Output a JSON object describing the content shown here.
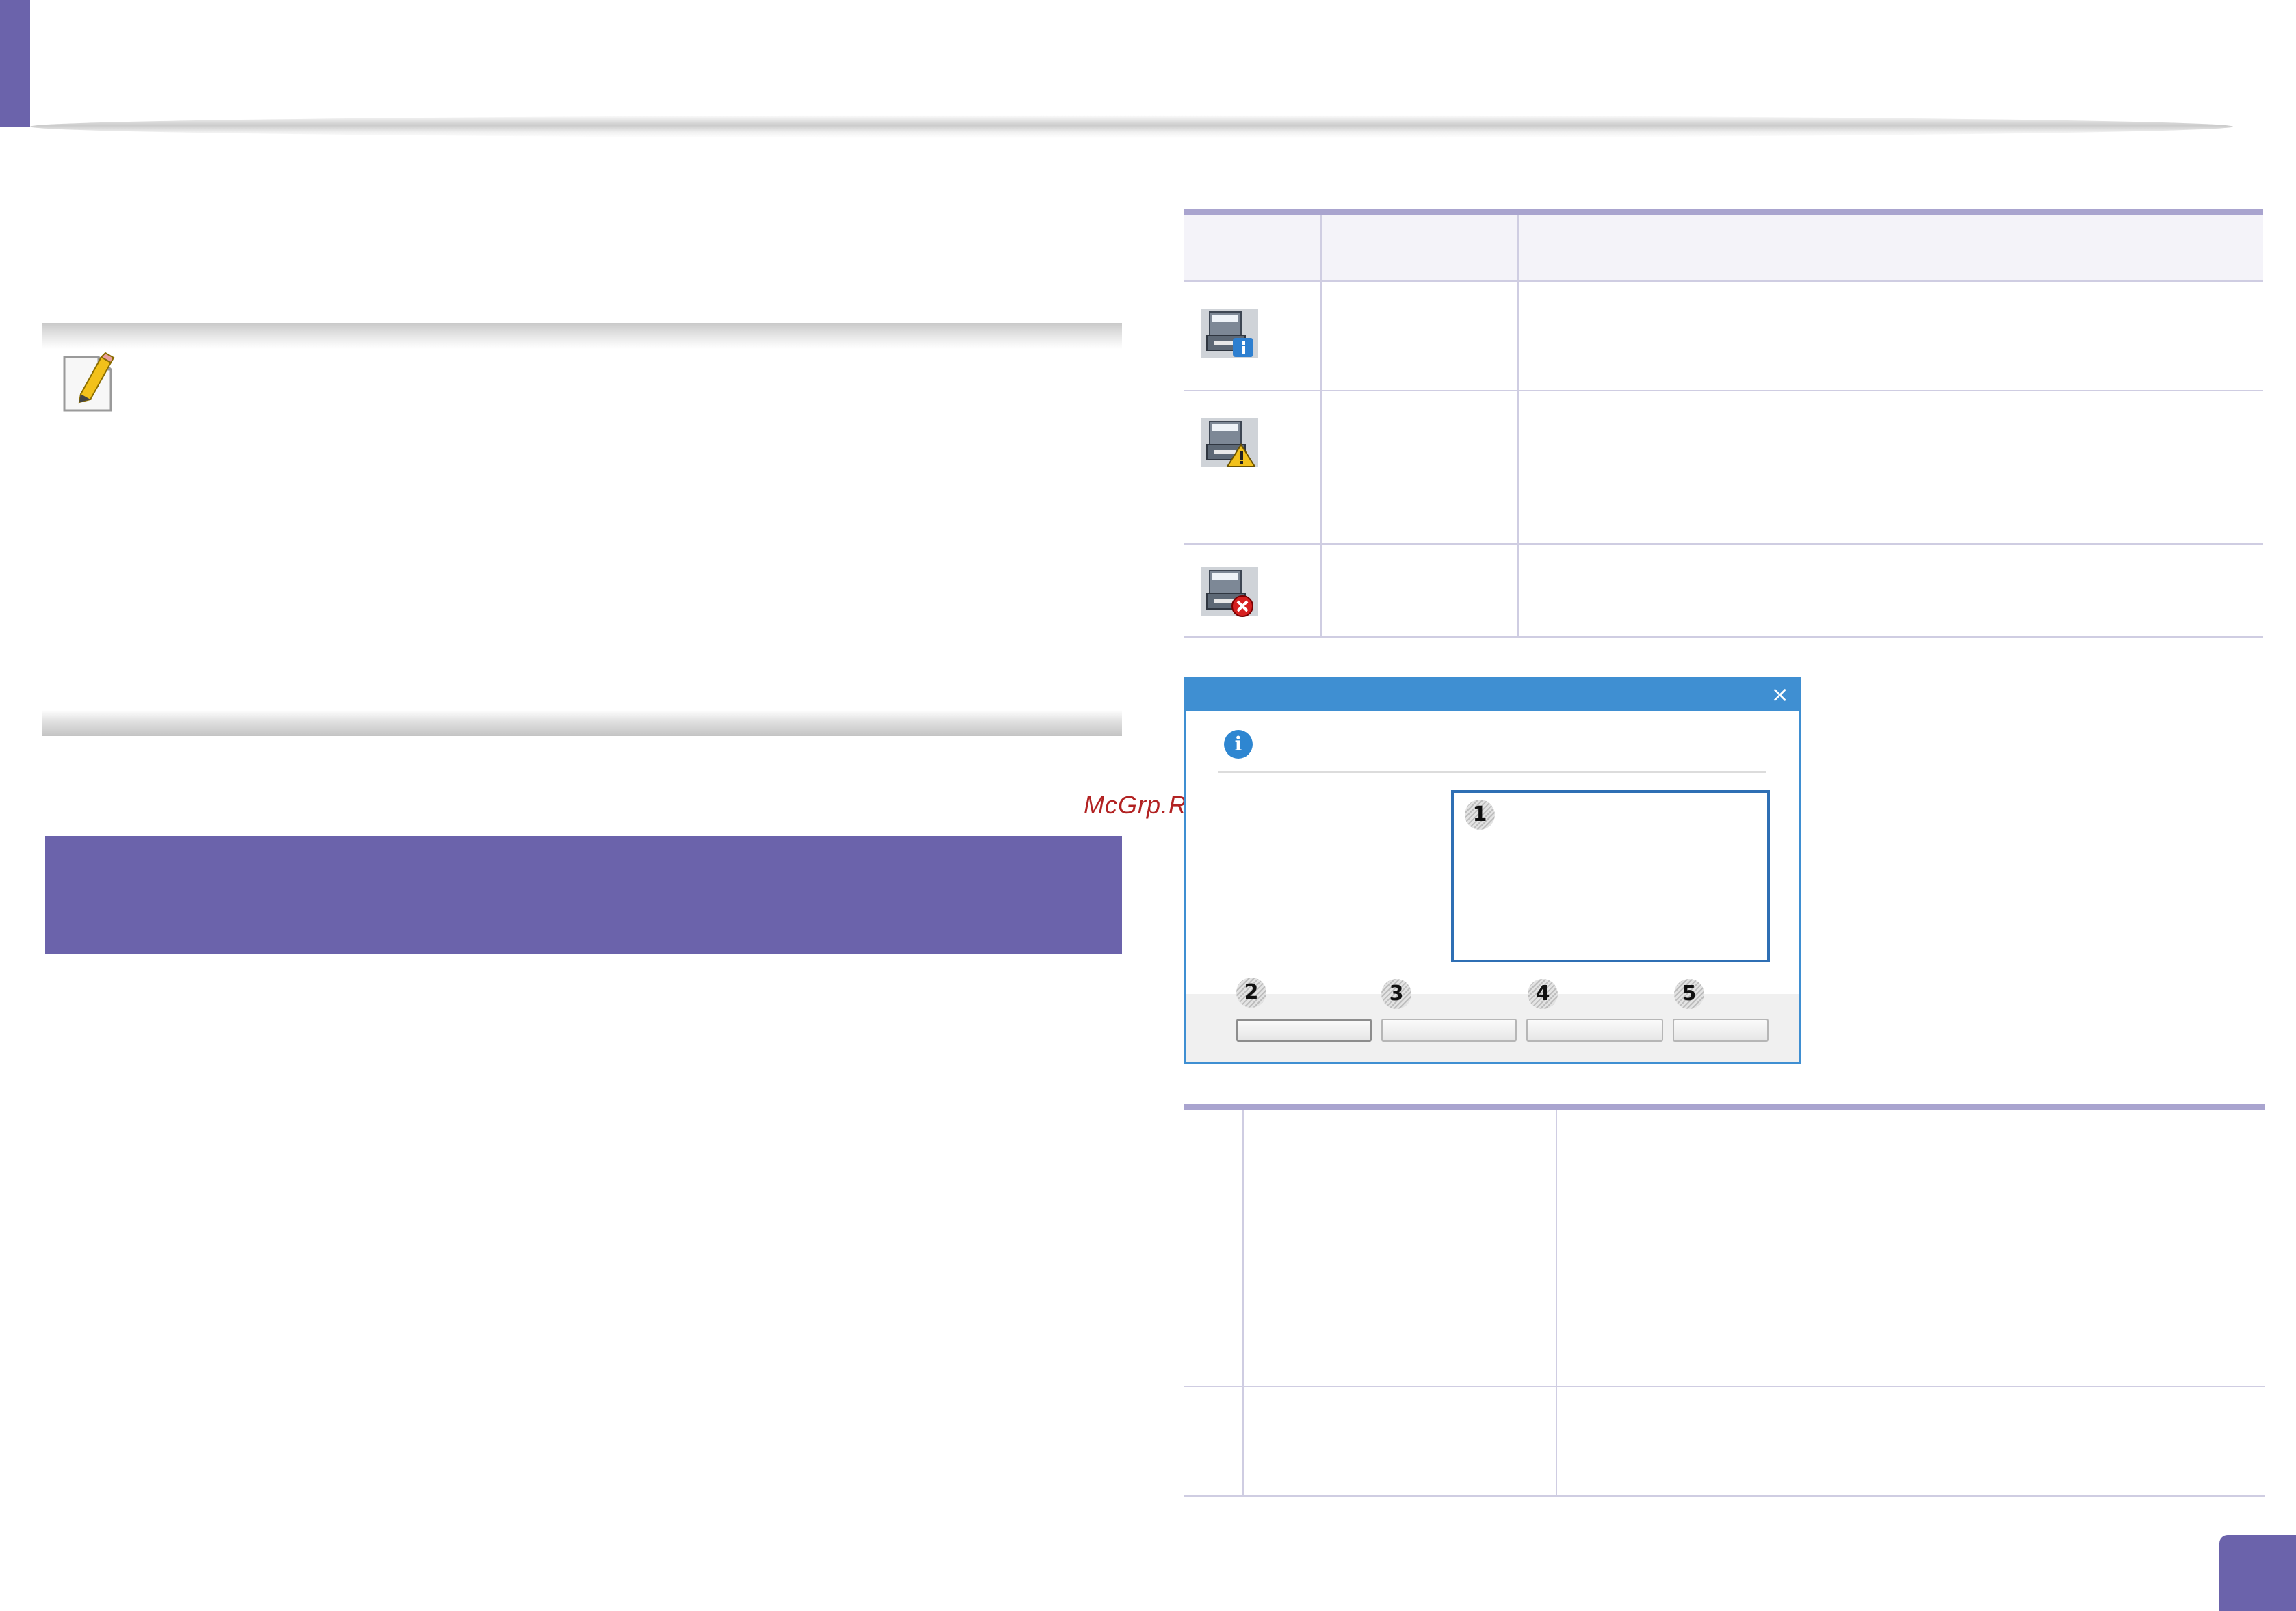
{
  "watermark": {
    "text": "McGrp.Ru"
  },
  "icons": {
    "note": "note-pencil-icon",
    "status_info": "printer-info-icon",
    "status_warning": "printer-warning-icon",
    "status_error": "printer-error-icon",
    "dialog_info": "info-icon",
    "dialog_close": "close-icon"
  },
  "dialog": {
    "close_glyph": "×",
    "info_glyph": "i",
    "callouts": [
      "1",
      "2",
      "3",
      "4",
      "5"
    ]
  },
  "colors": {
    "accent": "#6b63ab",
    "table_rule": "#a9a4cf",
    "dialog_blue": "#3f8fd2",
    "watermark": "#b22222"
  }
}
